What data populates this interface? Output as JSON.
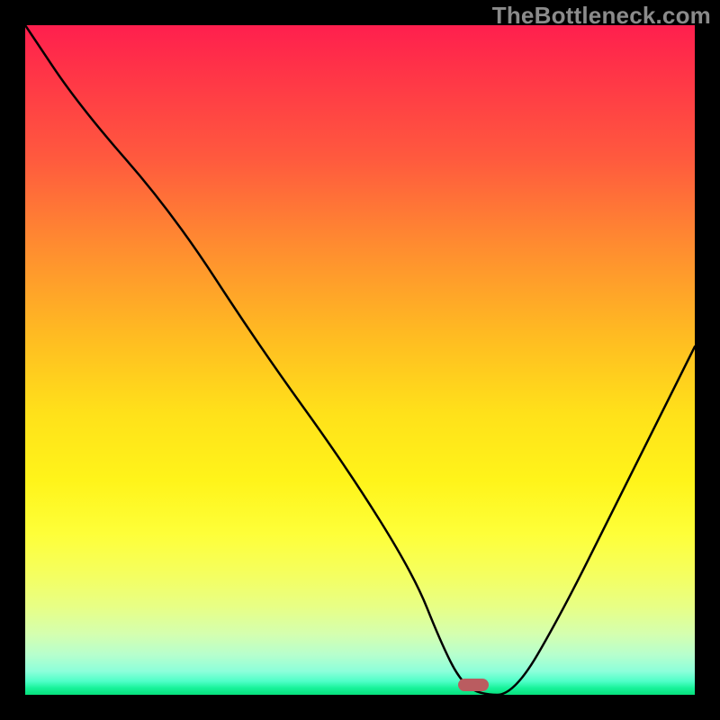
{
  "watermark": "TheBottleneck.com",
  "chart_data": {
    "type": "line",
    "title": "",
    "xlabel": "",
    "ylabel": "",
    "xlim": [
      0,
      100
    ],
    "ylim": [
      0,
      100
    ],
    "series": [
      {
        "name": "curve",
        "x": [
          0,
          8,
          22,
          35,
          48,
          58,
          62,
          65,
          68,
          73,
          80,
          88,
          96,
          100
        ],
        "y": [
          100,
          88,
          72,
          52,
          34,
          18,
          8,
          2,
          0,
          0,
          12,
          28,
          44,
          52
        ]
      }
    ],
    "marker": {
      "x": 67,
      "y": 1.5
    },
    "gradient_stops": [
      {
        "offset": 0,
        "color": "#ff1f4e"
      },
      {
        "offset": 0.2,
        "color": "#ff5a3e"
      },
      {
        "offset": 0.46,
        "color": "#ffba22"
      },
      {
        "offset": 0.76,
        "color": "#feff39"
      },
      {
        "offset": 0.94,
        "color": "#b7ffcd"
      },
      {
        "offset": 1.0,
        "color": "#07e07c"
      }
    ]
  }
}
